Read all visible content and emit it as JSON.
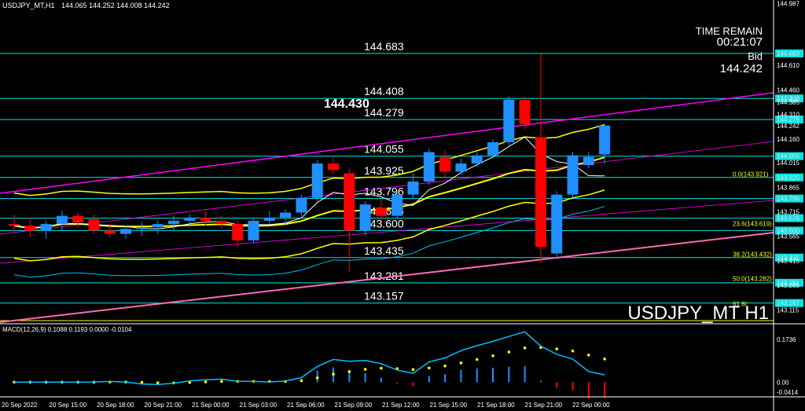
{
  "header": {
    "symbol_tf": "USDJPY_MT,H1",
    "ohlc": "144.065 144.252 144.008 144.242"
  },
  "overlay": {
    "time_remain_label": "TIME REMAIN",
    "time_remain_value": "00:21:07",
    "bid_label": "Bid",
    "bid_value": "144.242",
    "watermark": "USDJPY_MT H1",
    "marker_price": "144.430"
  },
  "colors": {
    "background": "#000000",
    "bull": "#1e90ff",
    "bear": "#ff0000",
    "level_line": "#00e5e5",
    "trend_line": "#ff00ff",
    "ma_line": "#ffff00",
    "macd_line": "#00bfff",
    "macd_signal": "#ffff00"
  },
  "chart_data": {
    "type": "candlestick",
    "price_range": [
      143.04,
      145.0
    ],
    "price_axis_ticks": [
      "144.987",
      "144.683",
      "144.610",
      "144.460",
      "144.408",
      "144.385",
      "144.310",
      "144.279",
      "144.242",
      "144.160",
      "144.055",
      "144.015",
      "143.925",
      "143.865",
      "143.796",
      "143.715",
      "143.676",
      "143.600",
      "143.565",
      "143.435",
      "143.415",
      "143.281",
      "143.265",
      "143.157",
      "143.115"
    ],
    "time_labels": [
      "20 Sep 2022",
      "20 Sep 15:00",
      "20 Sep 18:00",
      "20 Sep 21:00",
      "21 Sep 00:00",
      "21 Sep 03:00",
      "21 Sep 06:00",
      "21 Sep 09:00",
      "21 Sep 12:00",
      "21 Sep 15:00",
      "21 Sep 18:00",
      "21 Sep 21:00",
      "22 Sep 00:00"
    ],
    "levels": [
      {
        "label": "144.683",
        "value": 144.683
      },
      {
        "label": "144.408",
        "value": 144.408
      },
      {
        "label": "144.279",
        "value": 144.279
      },
      {
        "label": "144.055",
        "value": 144.055
      },
      {
        "label": "143.925",
        "value": 143.925
      },
      {
        "label": "143.796",
        "value": 143.796
      },
      {
        "label": "143.676",
        "value": 143.676
      },
      {
        "label": "143.600",
        "value": 143.6
      },
      {
        "label": "143.435",
        "value": 143.435
      },
      {
        "label": "143.281",
        "value": 143.281
      },
      {
        "label": "143.157",
        "value": 143.157
      }
    ],
    "fib_labels": [
      {
        "label": "0.0(143.921)",
        "value": 143.921
      },
      {
        "label": "23.6(143.619)",
        "value": 143.619
      },
      {
        "label": "38.2(143.432)",
        "value": 143.432
      },
      {
        "label": "50.0(143.282)",
        "value": 143.282
      },
      {
        "label": "61.8(",
        "value": 143.13
      }
    ],
    "candles": [
      {
        "o": 143.64,
        "h": 143.7,
        "l": 143.58,
        "c": 143.63
      },
      {
        "o": 143.63,
        "h": 143.68,
        "l": 143.56,
        "c": 143.6
      },
      {
        "o": 143.6,
        "h": 143.66,
        "l": 143.55,
        "c": 143.64
      },
      {
        "o": 143.64,
        "h": 143.72,
        "l": 143.6,
        "c": 143.69
      },
      {
        "o": 143.69,
        "h": 143.71,
        "l": 143.62,
        "c": 143.65
      },
      {
        "o": 143.67,
        "h": 143.7,
        "l": 143.58,
        "c": 143.6
      },
      {
        "o": 143.6,
        "h": 143.64,
        "l": 143.56,
        "c": 143.58
      },
      {
        "o": 143.58,
        "h": 143.63,
        "l": 143.55,
        "c": 143.61
      },
      {
        "o": 143.61,
        "h": 143.65,
        "l": 143.57,
        "c": 143.62
      },
      {
        "o": 143.62,
        "h": 143.66,
        "l": 143.58,
        "c": 143.64
      },
      {
        "o": 143.64,
        "h": 143.69,
        "l": 143.6,
        "c": 143.66
      },
      {
        "o": 143.66,
        "h": 143.7,
        "l": 143.62,
        "c": 143.68
      },
      {
        "o": 143.68,
        "h": 143.72,
        "l": 143.63,
        "c": 143.66
      },
      {
        "o": 143.66,
        "h": 143.69,
        "l": 143.61,
        "c": 143.64
      },
      {
        "o": 143.64,
        "h": 143.66,
        "l": 143.5,
        "c": 143.54
      },
      {
        "o": 143.54,
        "h": 143.68,
        "l": 143.52,
        "c": 143.66
      },
      {
        "o": 143.66,
        "h": 143.72,
        "l": 143.64,
        "c": 143.68
      },
      {
        "o": 143.68,
        "h": 143.73,
        "l": 143.64,
        "c": 143.71
      },
      {
        "o": 143.71,
        "h": 143.82,
        "l": 143.69,
        "c": 143.8
      },
      {
        "o": 143.8,
        "h": 144.03,
        "l": 143.78,
        "c": 144.01
      },
      {
        "o": 144.01,
        "h": 144.05,
        "l": 143.94,
        "c": 143.97
      },
      {
        "o": 143.95,
        "h": 143.98,
        "l": 143.35,
        "c": 143.6
      },
      {
        "o": 143.6,
        "h": 143.78,
        "l": 143.57,
        "c": 143.76
      },
      {
        "o": 143.74,
        "h": 143.79,
        "l": 143.66,
        "c": 143.69
      },
      {
        "o": 143.69,
        "h": 143.84,
        "l": 143.67,
        "c": 143.82
      },
      {
        "o": 143.82,
        "h": 143.95,
        "l": 143.8,
        "c": 143.9
      },
      {
        "o": 143.9,
        "h": 144.1,
        "l": 143.88,
        "c": 144.08
      },
      {
        "o": 144.05,
        "h": 144.09,
        "l": 143.92,
        "c": 143.96
      },
      {
        "o": 143.96,
        "h": 144.04,
        "l": 143.94,
        "c": 144.01
      },
      {
        "o": 144.01,
        "h": 144.08,
        "l": 143.99,
        "c": 144.06
      },
      {
        "o": 144.06,
        "h": 144.16,
        "l": 144.04,
        "c": 144.14
      },
      {
        "o": 144.14,
        "h": 144.42,
        "l": 144.12,
        "c": 144.4
      },
      {
        "o": 144.4,
        "h": 144.42,
        "l": 144.22,
        "c": 144.25
      },
      {
        "o": 144.17,
        "h": 144.68,
        "l": 143.4,
        "c": 143.5
      },
      {
        "o": 143.46,
        "h": 143.84,
        "l": 143.44,
        "c": 143.82
      },
      {
        "o": 143.82,
        "h": 144.08,
        "l": 143.8,
        "c": 144.06
      },
      {
        "o": 144.0,
        "h": 144.08,
        "l": 143.98,
        "c": 144.05
      },
      {
        "o": 144.065,
        "h": 144.252,
        "l": 144.008,
        "c": 144.242
      }
    ],
    "macd": {
      "label": "MACD(12,26,9) 0.1088 0.1193 0.0000 -0.0104",
      "axis_ticks": [
        "0.1736",
        "0.00",
        "-0.0414"
      ],
      "range": [
        -0.06,
        0.2
      ]
    }
  }
}
